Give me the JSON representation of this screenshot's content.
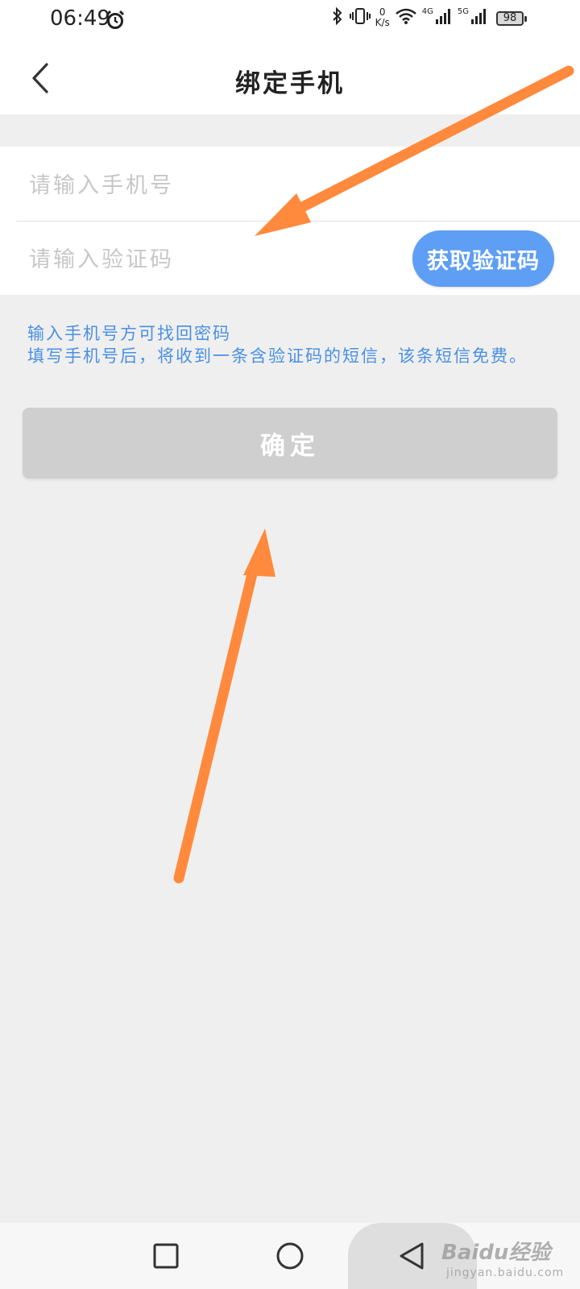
{
  "status_bar": {
    "time": "06:49",
    "net_speed_value": "0",
    "net_speed_unit": "K/s",
    "signal1_label": "4G",
    "signal2_label": "5G",
    "battery": "98",
    "icons": [
      "alarm-icon",
      "bluetooth-icon",
      "vibrate-icon",
      "wifi-icon",
      "signal-icon",
      "battery-icon"
    ]
  },
  "header": {
    "title": "绑定手机"
  },
  "form": {
    "phone_placeholder": "请输入手机号",
    "code_placeholder": "请输入验证码",
    "get_code_label": "获取验证码"
  },
  "hints": {
    "line1": "输入手机号方可找回密码",
    "line2": "填写手机号后，将收到一条含验证码的短信，该条短信免费。"
  },
  "confirm_label": "确定",
  "colors": {
    "accent": "#5e9ef4",
    "hint_text": "#4a90e2",
    "arrow": "#ff8a3d",
    "disabled_button": "#cfcfcf"
  },
  "watermark": {
    "main": "Baidu经验",
    "sub": "jingyan.baidu.com"
  }
}
